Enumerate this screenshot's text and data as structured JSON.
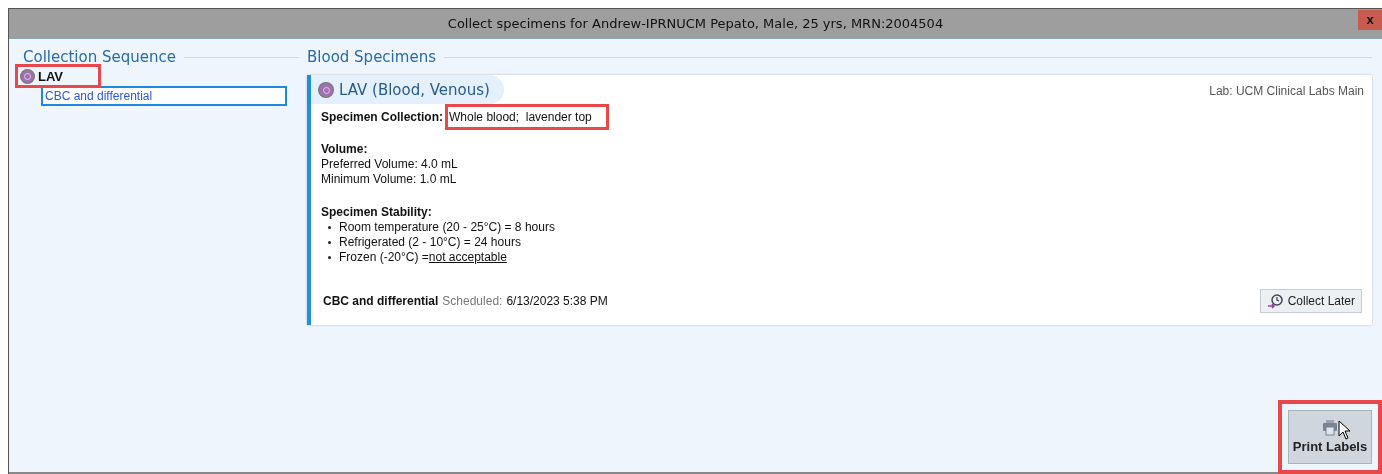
{
  "window": {
    "title": "Collect specimens for Andrew-IPRNUCM Pepato, Male, 25 yrs,  MRN:2004504",
    "close": "x"
  },
  "collection_sequence": {
    "heading": "Collection Sequence",
    "groups": [
      {
        "label": "LAV",
        "color": "#a070b0",
        "children": [
          {
            "label": "CBC and differential",
            "selected": true
          }
        ]
      }
    ]
  },
  "blood_specimens": {
    "heading": "Blood Specimens",
    "card": {
      "title": "LAV (Blood, Venous)",
      "color": "#a070b0",
      "lab": "Lab: UCM Clinical Labs Main",
      "collection_label": "Specimen Collection:",
      "collection_value": "Whole blood;  lavender top",
      "volume_heading": "Volume:",
      "volume_lines": [
        "Preferred Volume: 4.0 mL",
        "Minimum Volume: 1.0 mL"
      ],
      "stability_heading": "Specimen Stability:",
      "stability_items": [
        {
          "text": "Room temperature (20 - 25°C) = 8 hours",
          "underlined": false
        },
        {
          "text": "Refrigerated (2 - 10°C) = 24 hours",
          "underlined": false
        },
        {
          "text": "Frozen (-20°C) = ",
          "underlined": false
        },
        {
          "text": "not acceptable",
          "underlined": true
        }
      ],
      "order": "CBC and differential",
      "scheduled_label": "Scheduled:",
      "scheduled_value": "6/13/2023 5:38 PM",
      "collect_later": "Collect Later"
    }
  },
  "print_labels": "Print Labels"
}
